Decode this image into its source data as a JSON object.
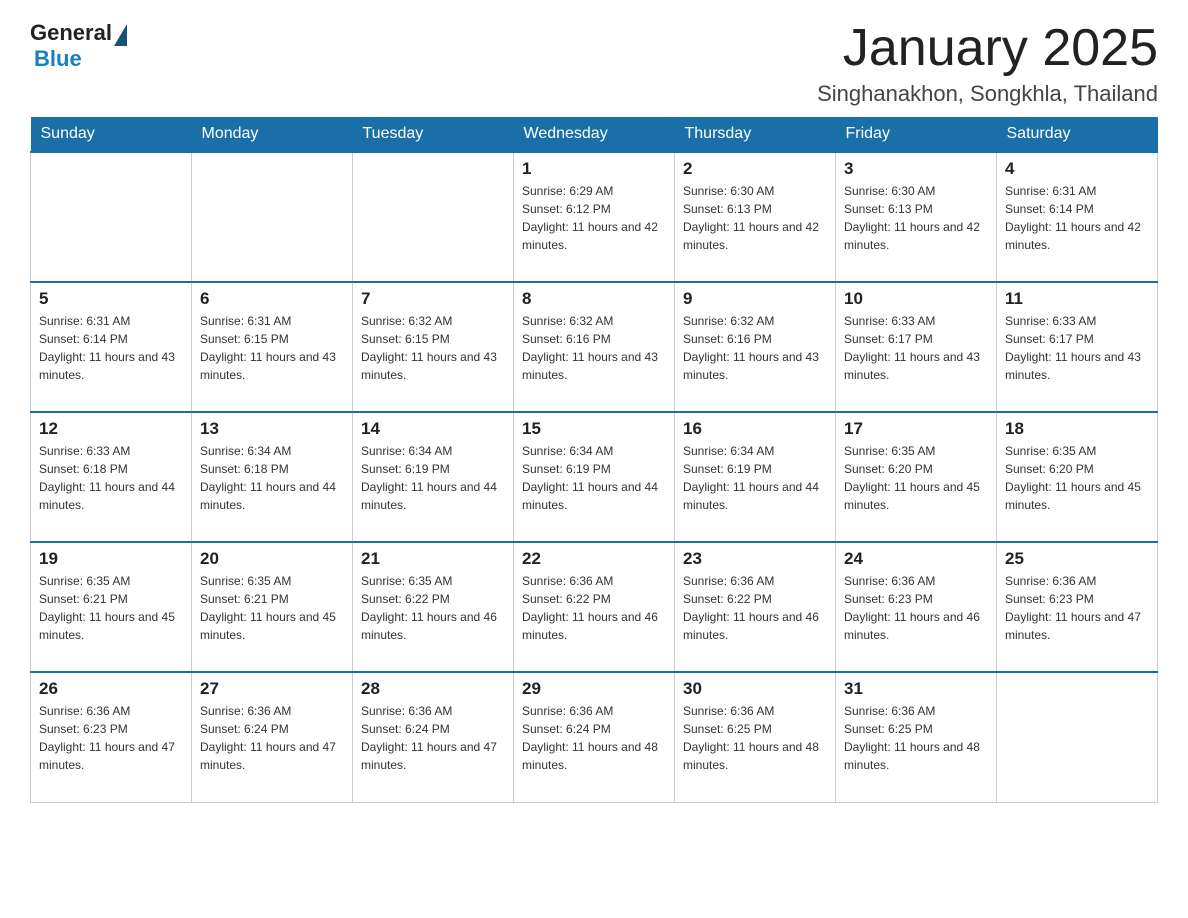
{
  "header": {
    "logo_general": "General",
    "logo_blue": "Blue",
    "title": "January 2025",
    "subtitle": "Singhanakhon, Songkhla, Thailand"
  },
  "days_of_week": [
    "Sunday",
    "Monday",
    "Tuesday",
    "Wednesday",
    "Thursday",
    "Friday",
    "Saturday"
  ],
  "weeks": [
    [
      {
        "day": "",
        "info": ""
      },
      {
        "day": "",
        "info": ""
      },
      {
        "day": "",
        "info": ""
      },
      {
        "day": "1",
        "info": "Sunrise: 6:29 AM\nSunset: 6:12 PM\nDaylight: 11 hours and 42 minutes."
      },
      {
        "day": "2",
        "info": "Sunrise: 6:30 AM\nSunset: 6:13 PM\nDaylight: 11 hours and 42 minutes."
      },
      {
        "day": "3",
        "info": "Sunrise: 6:30 AM\nSunset: 6:13 PM\nDaylight: 11 hours and 42 minutes."
      },
      {
        "day": "4",
        "info": "Sunrise: 6:31 AM\nSunset: 6:14 PM\nDaylight: 11 hours and 42 minutes."
      }
    ],
    [
      {
        "day": "5",
        "info": "Sunrise: 6:31 AM\nSunset: 6:14 PM\nDaylight: 11 hours and 43 minutes."
      },
      {
        "day": "6",
        "info": "Sunrise: 6:31 AM\nSunset: 6:15 PM\nDaylight: 11 hours and 43 minutes."
      },
      {
        "day": "7",
        "info": "Sunrise: 6:32 AM\nSunset: 6:15 PM\nDaylight: 11 hours and 43 minutes."
      },
      {
        "day": "8",
        "info": "Sunrise: 6:32 AM\nSunset: 6:16 PM\nDaylight: 11 hours and 43 minutes."
      },
      {
        "day": "9",
        "info": "Sunrise: 6:32 AM\nSunset: 6:16 PM\nDaylight: 11 hours and 43 minutes."
      },
      {
        "day": "10",
        "info": "Sunrise: 6:33 AM\nSunset: 6:17 PM\nDaylight: 11 hours and 43 minutes."
      },
      {
        "day": "11",
        "info": "Sunrise: 6:33 AM\nSunset: 6:17 PM\nDaylight: 11 hours and 43 minutes."
      }
    ],
    [
      {
        "day": "12",
        "info": "Sunrise: 6:33 AM\nSunset: 6:18 PM\nDaylight: 11 hours and 44 minutes."
      },
      {
        "day": "13",
        "info": "Sunrise: 6:34 AM\nSunset: 6:18 PM\nDaylight: 11 hours and 44 minutes."
      },
      {
        "day": "14",
        "info": "Sunrise: 6:34 AM\nSunset: 6:19 PM\nDaylight: 11 hours and 44 minutes."
      },
      {
        "day": "15",
        "info": "Sunrise: 6:34 AM\nSunset: 6:19 PM\nDaylight: 11 hours and 44 minutes."
      },
      {
        "day": "16",
        "info": "Sunrise: 6:34 AM\nSunset: 6:19 PM\nDaylight: 11 hours and 44 minutes."
      },
      {
        "day": "17",
        "info": "Sunrise: 6:35 AM\nSunset: 6:20 PM\nDaylight: 11 hours and 45 minutes."
      },
      {
        "day": "18",
        "info": "Sunrise: 6:35 AM\nSunset: 6:20 PM\nDaylight: 11 hours and 45 minutes."
      }
    ],
    [
      {
        "day": "19",
        "info": "Sunrise: 6:35 AM\nSunset: 6:21 PM\nDaylight: 11 hours and 45 minutes."
      },
      {
        "day": "20",
        "info": "Sunrise: 6:35 AM\nSunset: 6:21 PM\nDaylight: 11 hours and 45 minutes."
      },
      {
        "day": "21",
        "info": "Sunrise: 6:35 AM\nSunset: 6:22 PM\nDaylight: 11 hours and 46 minutes."
      },
      {
        "day": "22",
        "info": "Sunrise: 6:36 AM\nSunset: 6:22 PM\nDaylight: 11 hours and 46 minutes."
      },
      {
        "day": "23",
        "info": "Sunrise: 6:36 AM\nSunset: 6:22 PM\nDaylight: 11 hours and 46 minutes."
      },
      {
        "day": "24",
        "info": "Sunrise: 6:36 AM\nSunset: 6:23 PM\nDaylight: 11 hours and 46 minutes."
      },
      {
        "day": "25",
        "info": "Sunrise: 6:36 AM\nSunset: 6:23 PM\nDaylight: 11 hours and 47 minutes."
      }
    ],
    [
      {
        "day": "26",
        "info": "Sunrise: 6:36 AM\nSunset: 6:23 PM\nDaylight: 11 hours and 47 minutes."
      },
      {
        "day": "27",
        "info": "Sunrise: 6:36 AM\nSunset: 6:24 PM\nDaylight: 11 hours and 47 minutes."
      },
      {
        "day": "28",
        "info": "Sunrise: 6:36 AM\nSunset: 6:24 PM\nDaylight: 11 hours and 47 minutes."
      },
      {
        "day": "29",
        "info": "Sunrise: 6:36 AM\nSunset: 6:24 PM\nDaylight: 11 hours and 48 minutes."
      },
      {
        "day": "30",
        "info": "Sunrise: 6:36 AM\nSunset: 6:25 PM\nDaylight: 11 hours and 48 minutes."
      },
      {
        "day": "31",
        "info": "Sunrise: 6:36 AM\nSunset: 6:25 PM\nDaylight: 11 hours and 48 minutes."
      },
      {
        "day": "",
        "info": ""
      }
    ]
  ]
}
